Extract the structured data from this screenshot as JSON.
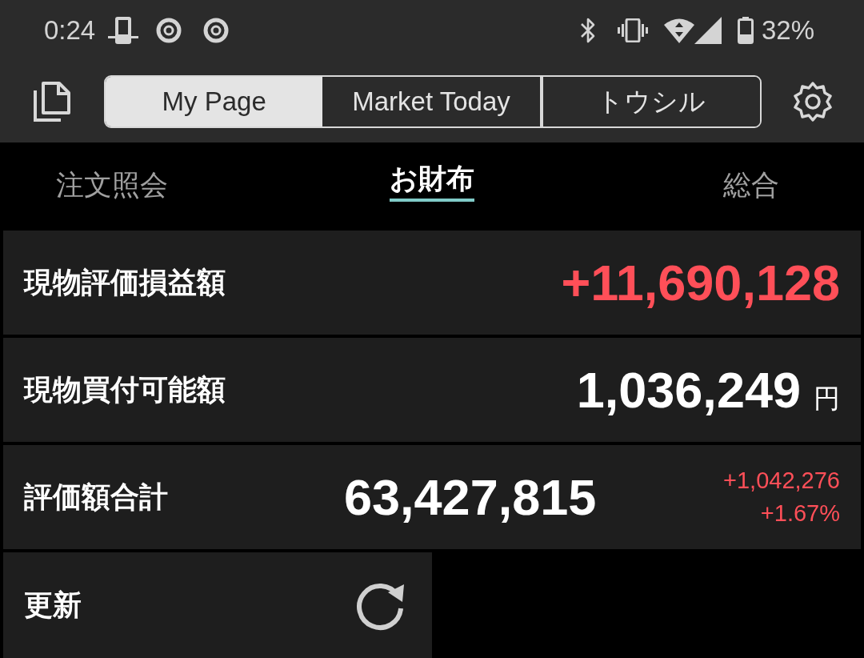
{
  "status_bar": {
    "time": "0:24",
    "battery": "32%"
  },
  "app_bar": {
    "tabs": [
      {
        "label": "My Page",
        "selected": true
      },
      {
        "label": "Market Today",
        "selected": false
      },
      {
        "label": "トウシル",
        "selected": false
      }
    ]
  },
  "sub_tabs": [
    {
      "label": "注文照会",
      "selected": false
    },
    {
      "label": "お財布",
      "selected": true
    },
    {
      "label": "総合",
      "selected": false
    }
  ],
  "rows": [
    {
      "kind": "gain",
      "label": "現物評価損益額",
      "value": "+11,690,128"
    },
    {
      "kind": "amount",
      "label": "現物買付可能額",
      "value": "1,036,249",
      "unit": "円"
    },
    {
      "kind": "total",
      "label": "評価額合計",
      "value": "63,427,815",
      "change": "+1,042,276",
      "change_percent": "+1.67%"
    }
  ],
  "refresh": {
    "label": "更新"
  }
}
